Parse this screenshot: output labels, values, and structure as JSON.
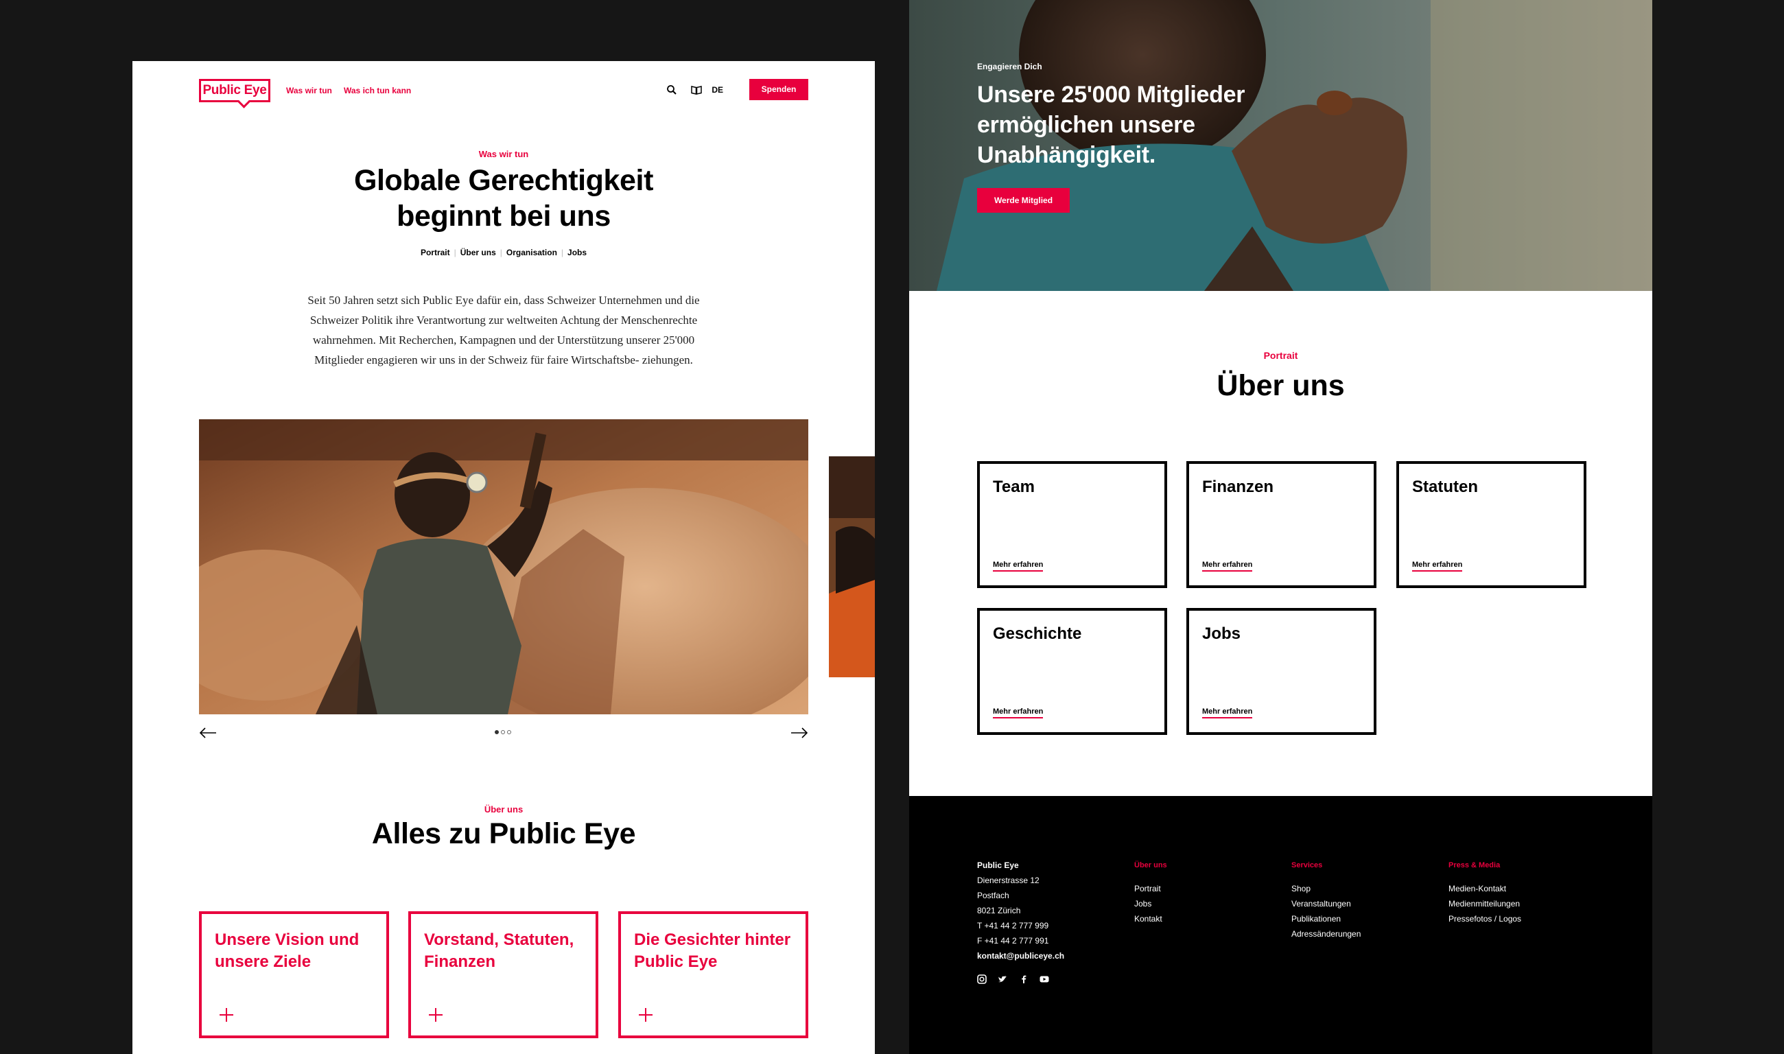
{
  "left_page": {
    "logo": "Public Eye",
    "nav": {
      "link_1": "Was wir tun",
      "link_2": "Was ich tun kann",
      "lang": "DE",
      "donate": "Spenden",
      "icons": [
        "search-icon",
        "book-icon"
      ]
    },
    "hero": {
      "kicker": "Was wir tun",
      "title_line1": "Globale Gerechtigkeit",
      "title_line2": "beginnt bei uns",
      "subnav": [
        "Portrait",
        "Über uns",
        "Organisation",
        "Jobs"
      ],
      "intro": "Seit 50 Jahren setzt sich Public Eye dafür ein, dass Schweizer Unternehmen und die Schweizer Politik ihre Verantwortung zur weltweiten Achtung der Menschenrechte wahrnehmen. Mit Recherchen, Kampagnen und der Unterstützung unserer 25'000 Mitglieder engagieren wir uns in der Schweiz für faire Wirtschaftsbe- ziehungen."
    },
    "carousel": {
      "slides": 3,
      "active": 1
    },
    "section": {
      "kicker": "Über uns",
      "title": "Alles zu Public Eye",
      "cards": [
        "Unsere Vision und unsere Ziele",
        "Vorstand, Statuten, Finanzen",
        "Die Gesichter hinter Public Eye"
      ]
    }
  },
  "right_page": {
    "hero": {
      "kicker": "Engagieren Dich",
      "title": "Unsere 25'000 Mitglieder ermöglichen unsere Unabhängigkeit.",
      "button": "Werde Mitglied"
    },
    "about": {
      "kicker": "Portrait",
      "title": "Über uns",
      "more_label": "Mehr erfahren",
      "cards": [
        "Team",
        "Finanzen",
        "Statuten",
        "Geschichte",
        "Jobs"
      ]
    },
    "footer": {
      "address": {
        "name": "Public Eye",
        "street": "Dienerstrasse 12",
        "box": "Postfach",
        "city": "8021 Zürich",
        "phone": "T  +41 44 2 777 999",
        "fax": "F  +41 44 2 777 991",
        "email": "kontakt@publiceye.ch"
      },
      "col_1": {
        "heading": "Über uns",
        "links": [
          "Portrait",
          "Jobs",
          "Kontakt"
        ]
      },
      "col_2": {
        "heading": "Services",
        "links": [
          "Shop",
          "Veranstaltungen",
          "Publikationen",
          "Adressänderungen"
        ]
      },
      "col_3": {
        "heading": "Press & Media",
        "links": [
          "Medien-Kontakt",
          "Medienmitteilungen",
          "Pressefotos / Logos"
        ]
      },
      "social_icons": [
        "instagram-icon",
        "twitter-icon",
        "facebook-icon",
        "youtube-icon"
      ]
    }
  },
  "colors": {
    "accent": "#e8003d",
    "background": "#161616",
    "footer": "#000000"
  }
}
